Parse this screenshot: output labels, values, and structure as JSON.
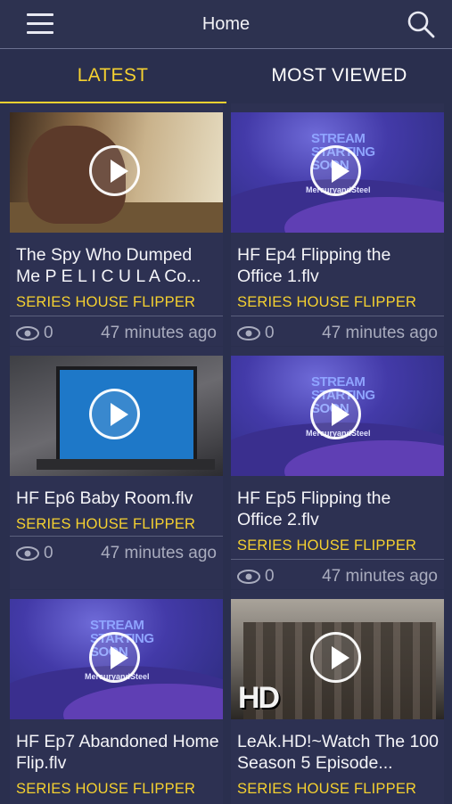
{
  "header": {
    "title": "Home",
    "menu_icon": "hamburger-menu-icon",
    "search_icon": "search-icon"
  },
  "tabs": [
    {
      "label": "LATEST",
      "active": true
    },
    {
      "label": "MOST VIEWED",
      "active": false
    }
  ],
  "colors": {
    "accent": "#f5d130",
    "background": "#2a2f4e",
    "card": "#2d3152"
  },
  "videos": [
    {
      "title": "The Spy Who Dumped Me P E L I C U L A Co...",
      "series": "SERIES HOUSE FLIPPER",
      "views": "0",
      "ago": "47 minutes ago"
    },
    {
      "title": "HF Ep4 Flipping the Office 1.flv",
      "series": "SERIES HOUSE FLIPPER",
      "views": "0",
      "ago": "47 minutes ago"
    },
    {
      "title": "HF Ep6 Baby Room.flv",
      "series": "SERIES HOUSE FLIPPER",
      "views": "0",
      "ago": "47 minutes ago"
    },
    {
      "title": "HF Ep5 Flipping the Office 2.flv",
      "series": "SERIES HOUSE FLIPPER",
      "views": "0",
      "ago": "47 minutes ago"
    },
    {
      "title": "HF Ep7 Abandoned Home Flip.flv",
      "series": "SERIES HOUSE FLIPPER",
      "views": "",
      "ago": ""
    },
    {
      "title": "LeAk.HD!~Watch The 100 Season 5 Episode...",
      "series": "SERIES HOUSE FLIPPER",
      "views": "",
      "ago": ""
    }
  ],
  "thumbnails": {
    "stream_text": "STREAM\nSTARTING\nSOON",
    "stream_sub": "MercuryandSteel",
    "hd_label": "HD"
  }
}
